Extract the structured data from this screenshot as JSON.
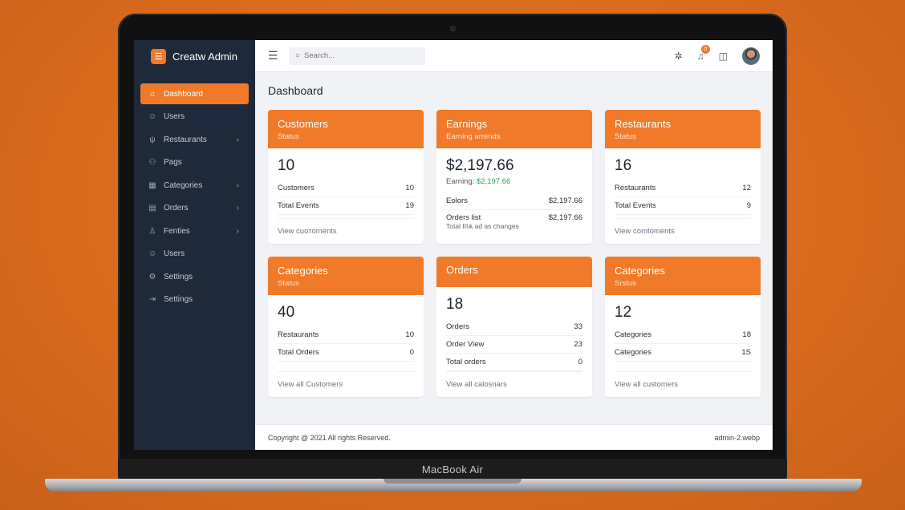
{
  "device": {
    "label": "MacBook Air"
  },
  "brand": {
    "name": "Creatw Admin"
  },
  "sidebar": {
    "items": [
      {
        "label": "Dashboard",
        "icon": "home-icon",
        "active": true,
        "chevron": false
      },
      {
        "label": "Users",
        "icon": "user-icon",
        "chevron": false
      },
      {
        "label": "Restaurants",
        "icon": "utensils-icon",
        "chevron": true
      },
      {
        "label": "Pags",
        "icon": "users-icon",
        "chevron": false
      },
      {
        "label": "Categories",
        "icon": "grid-icon",
        "chevron": true
      },
      {
        "label": "Orders",
        "icon": "document-icon",
        "chevron": true
      },
      {
        "label": "Fenties",
        "icon": "person-icon",
        "chevron": true
      },
      {
        "label": "Users",
        "icon": "user-icon",
        "chevron": false
      },
      {
        "label": "Settings",
        "icon": "gear-icon",
        "chevron": false
      },
      {
        "label": "Settings",
        "icon": "logout-icon",
        "chevron": false
      }
    ]
  },
  "topbar": {
    "search_placeholder": "Search...",
    "notification_count": "0"
  },
  "page": {
    "title": "Dashboard"
  },
  "cards": [
    {
      "title": "Customers",
      "subtitle": "Status",
      "big": "10",
      "rows": [
        {
          "label": "Customers",
          "value": "10"
        },
        {
          "label": "Total Events",
          "value": "19"
        }
      ],
      "footer": "View cuотoments"
    },
    {
      "title": "Earnings",
      "subtitle": "Earning arrends",
      "big": "$2,197.66",
      "sub_prefix": "Earning:",
      "sub_value": "$2,197.66",
      "rows": [
        {
          "label": "Eolors",
          "value": "$2,197.66"
        },
        {
          "label": "Orders list",
          "value": "$2,197.66"
        }
      ],
      "note": "Total ІІІѫ ad as changes"
    },
    {
      "title": "Restaurants",
      "subtitle": "Status",
      "big": "16",
      "rows": [
        {
          "label": "Restaurants",
          "value": "12"
        },
        {
          "label": "Total Events",
          "value": "9"
        }
      ],
      "footer": "View comtoments"
    },
    {
      "title": "Categories",
      "subtitle": "Status",
      "big": "40",
      "rows": [
        {
          "label": "Restaurants",
          "value": "10"
        },
        {
          "label": "Total Orders",
          "value": "0"
        }
      ],
      "footer": "View all Customers"
    },
    {
      "title": "Orders",
      "big": "18",
      "rows": [
        {
          "label": "Orders",
          "value": "33"
        },
        {
          "label": "Order View",
          "value": "23"
        },
        {
          "label": "Total orders",
          "value": "0"
        }
      ],
      "footer": "View all calosnars"
    },
    {
      "title": "Categories",
      "subtitle": "Srstus",
      "big": "12",
      "rows": [
        {
          "label": "Categories",
          "value": "18"
        },
        {
          "label": "Categories",
          "value": "1S"
        }
      ],
      "footer": "View all customers"
    }
  ],
  "footer": {
    "copyright": "Copyright @ 2021 All rights Reserved.",
    "file": "admin-2.webp"
  },
  "colors": {
    "accent": "#f07a2a",
    "sidebar": "#1e2a3b",
    "green": "#2e9d5b"
  }
}
